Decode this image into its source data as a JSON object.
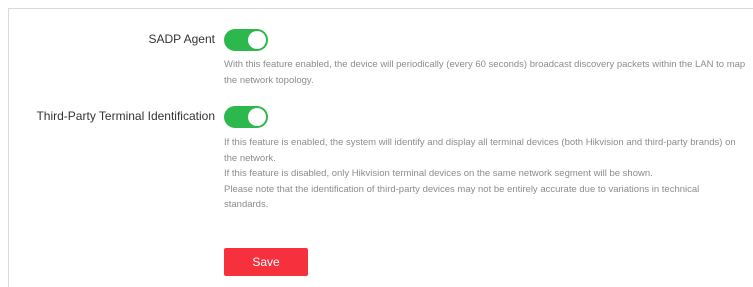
{
  "settings": {
    "sadp": {
      "label": "SADP Agent",
      "enabled": true,
      "description": "With this feature enabled, the device will periodically (every 60 seconds) broadcast discovery packets within the LAN to map the network topology."
    },
    "third_party": {
      "label": "Third-Party Terminal Identification",
      "enabled": true,
      "description_lines": [
        "If this feature is enabled, the system will identify and display all terminal devices (both Hikvision and third-party brands) on the network.",
        "If this feature is disabled, only Hikvision terminal devices on the same network segment will be shown.",
        "Please note that the identification of third-party devices may not be entirely accurate due to variations in technical standards."
      ]
    }
  },
  "actions": {
    "save_label": "Save"
  },
  "colors": {
    "toggle_on": "#2db84d",
    "save_button": "#f7303e",
    "description_text": "#8c8c8c",
    "label_text": "#333333"
  }
}
